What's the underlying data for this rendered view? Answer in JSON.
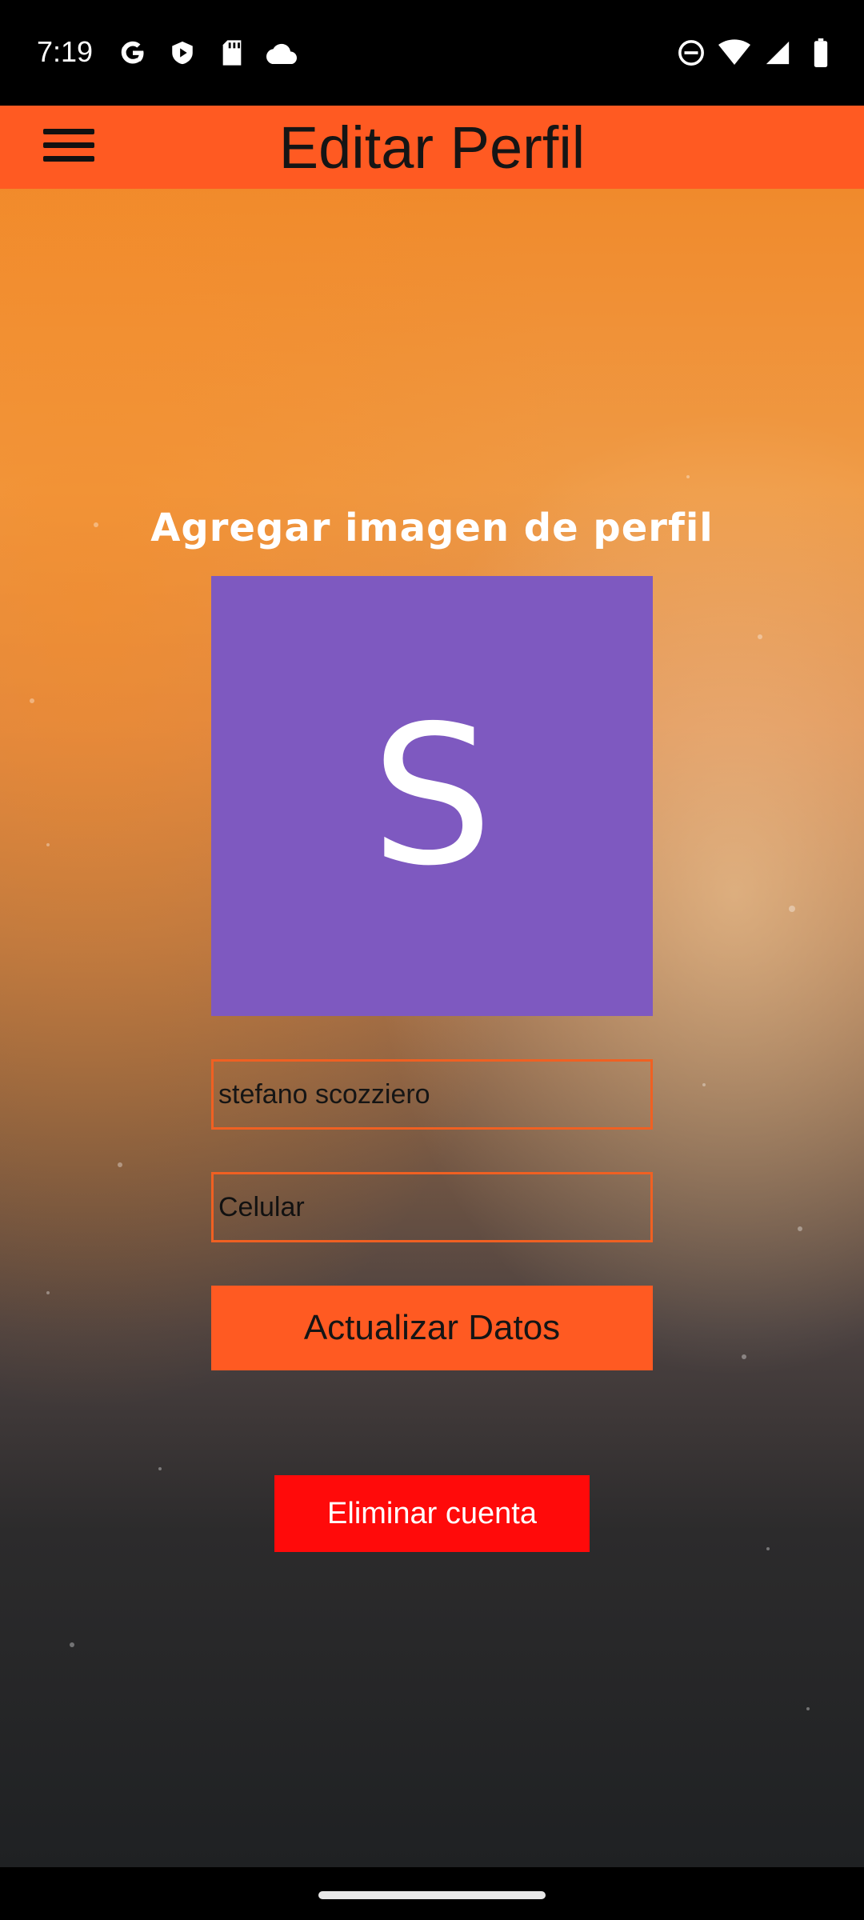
{
  "status_bar": {
    "time": "7:19",
    "left_icons": [
      "google-icon",
      "play-store-icon",
      "sd-card-icon",
      "cloud-icon"
    ],
    "right_icons": [
      "do-not-disturb-icon",
      "wifi-icon",
      "signal-icon",
      "battery-icon"
    ]
  },
  "app_bar": {
    "title": "Editar Perfil",
    "menu_icon": "hamburger-menu-icon",
    "background_color": "#ff5a22"
  },
  "profile": {
    "heading": "Agregar imagen de perfil",
    "avatar_letter": "S",
    "avatar_color": "#7e59c0"
  },
  "form": {
    "name_value": "stefano scozziero",
    "phone_placeholder": "Celular",
    "field_border_color": "#f06022"
  },
  "buttons": {
    "update_label": "Actualizar Datos",
    "update_color": "#ff5a22",
    "delete_label": "Eliminar cuenta",
    "delete_color": "#ff0a0a"
  }
}
